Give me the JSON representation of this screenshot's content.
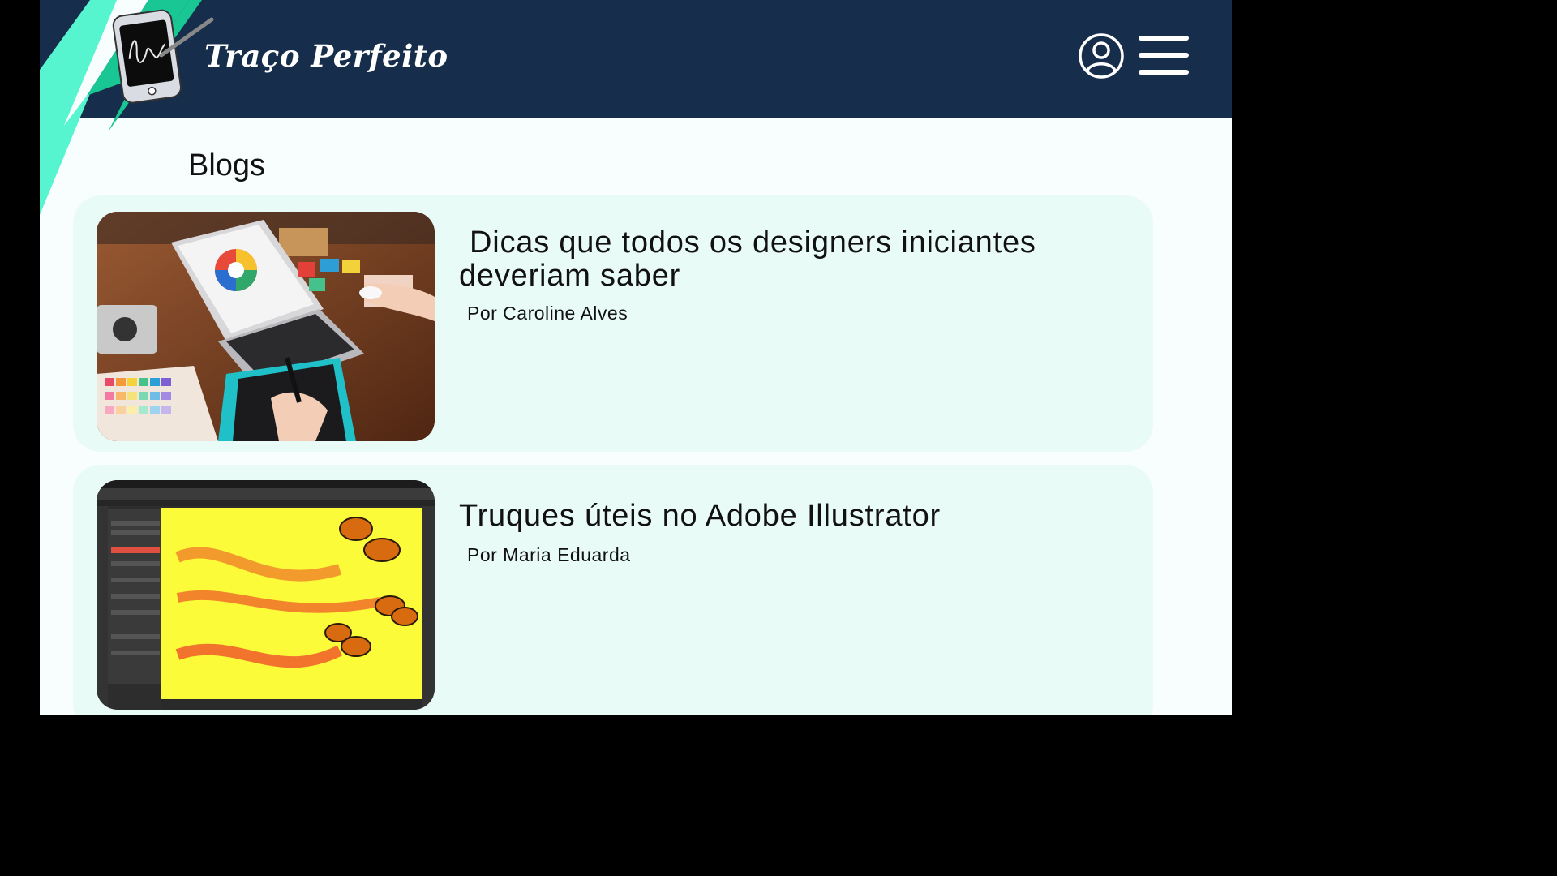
{
  "header": {
    "brand": "Traço Perfeito",
    "logo_icon": "tablet-pen-logo",
    "user_icon": "user-circle-icon",
    "menu_icon": "hamburger-menu-icon"
  },
  "main": {
    "section_title": "Blogs",
    "posts": [
      {
        "title": "Dicas que todos os designers iniciantes deveriam saber",
        "author": "Por Caroline Alves",
        "image": "designer-desk-photo"
      },
      {
        "title": "Truques úteis no Adobe Illustrator",
        "author": "Por Maria Eduarda",
        "image": "illustrator-butterflies-screenshot"
      }
    ]
  },
  "colors": {
    "header_bg": "#162d4b",
    "page_bg": "#f7fefd",
    "card_bg": "#e9fbf7",
    "accent_mint": "#56f5cf",
    "accent_green": "#19c795"
  }
}
